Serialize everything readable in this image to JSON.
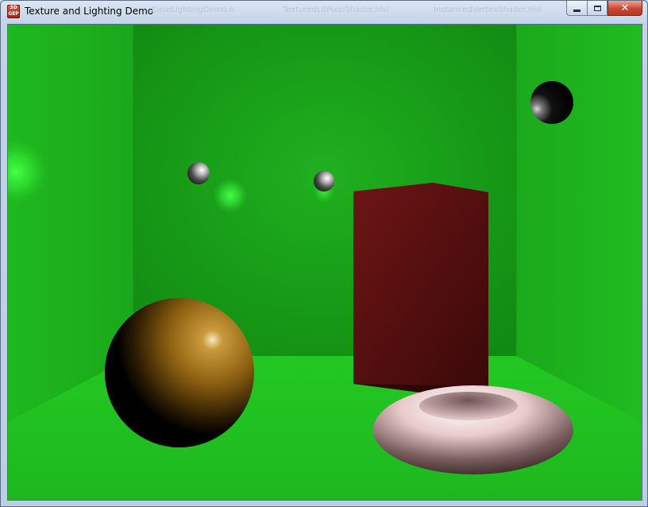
{
  "window": {
    "title": "Texture and Lighting Demo",
    "icon_text": "3D GEP",
    "background_tabs": [
      "...ltipleLightingDemo.h",
      "TexturedLitPixelShader.hlsl",
      "InstancedVertexShader.hlsl"
    ],
    "buttons": {
      "minimize": "minimize-icon",
      "maximize": "maximize-icon",
      "close": "close-icon"
    }
  },
  "scene": {
    "colors": {
      "wall": "#1fb41f",
      "back_wall": "#169a16",
      "floor": "#22c422",
      "box": "#5a1212",
      "gold_sphere": "#8a5e10",
      "torus": "#e8c8c8",
      "small_sphere": "#9a9a9a",
      "light": "#3dff3d"
    }
  }
}
